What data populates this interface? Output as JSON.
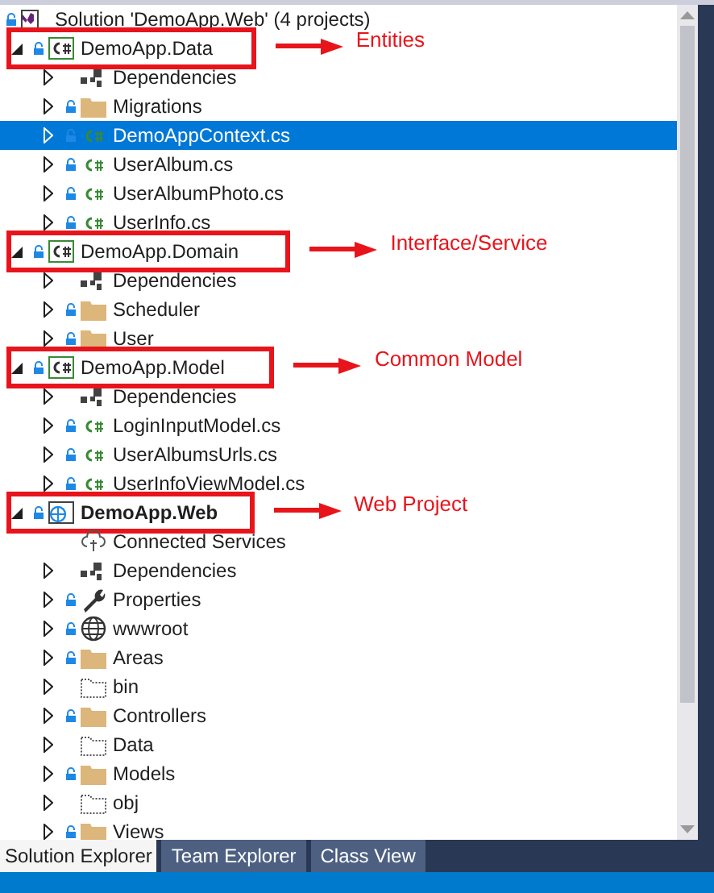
{
  "solution": {
    "title": "Solution 'DemoApp.Web' (4 projects)",
    "locked": true
  },
  "projects": [
    {
      "name": "DemoApp.Data",
      "kind": "csharp-project",
      "expandable": true,
      "expanded": true,
      "locked": true,
      "selected": false,
      "startup": false,
      "annotation": {
        "label": "Entities"
      },
      "children": [
        {
          "name": "Dependencies",
          "kind": "dependencies",
          "expandable": true,
          "expanded": false,
          "locked": false,
          "selected": false
        },
        {
          "name": "Migrations",
          "kind": "folder",
          "expandable": true,
          "expanded": false,
          "locked": true,
          "selected": false
        },
        {
          "name": "DemoAppContext.cs",
          "kind": "csharp-file",
          "expandable": true,
          "expanded": false,
          "locked": true,
          "selected": true
        },
        {
          "name": "UserAlbum.cs",
          "kind": "csharp-file",
          "expandable": true,
          "expanded": false,
          "locked": true,
          "selected": false
        },
        {
          "name": "UserAlbumPhoto.cs",
          "kind": "csharp-file",
          "expandable": true,
          "expanded": false,
          "locked": true,
          "selected": false
        },
        {
          "name": "UserInfo.cs",
          "kind": "csharp-file",
          "expandable": true,
          "expanded": false,
          "locked": true,
          "selected": false
        }
      ]
    },
    {
      "name": "DemoApp.Domain",
      "kind": "csharp-project",
      "expandable": true,
      "expanded": true,
      "locked": true,
      "selected": false,
      "startup": false,
      "annotation": {
        "label": "Interface/Service"
      },
      "children": [
        {
          "name": "Dependencies",
          "kind": "dependencies",
          "expandable": true,
          "expanded": false,
          "locked": false,
          "selected": false
        },
        {
          "name": "Scheduler",
          "kind": "folder",
          "expandable": true,
          "expanded": false,
          "locked": true,
          "selected": false
        },
        {
          "name": "User",
          "kind": "folder",
          "expandable": true,
          "expanded": false,
          "locked": true,
          "selected": false
        }
      ]
    },
    {
      "name": "DemoApp.Model",
      "kind": "csharp-project",
      "expandable": true,
      "expanded": true,
      "locked": true,
      "selected": false,
      "startup": false,
      "annotation": {
        "label": "Common Model"
      },
      "children": [
        {
          "name": "Dependencies",
          "kind": "dependencies",
          "expandable": true,
          "expanded": false,
          "locked": false,
          "selected": false
        },
        {
          "name": "LoginInputModel.cs",
          "kind": "csharp-file",
          "expandable": true,
          "expanded": false,
          "locked": true,
          "selected": false
        },
        {
          "name": "UserAlbumsUrls.cs",
          "kind": "csharp-file",
          "expandable": true,
          "expanded": false,
          "locked": true,
          "selected": false
        },
        {
          "name": "UserInfoViewModel.cs",
          "kind": "csharp-file",
          "expandable": true,
          "expanded": false,
          "locked": true,
          "selected": false
        }
      ]
    },
    {
      "name": "DemoApp.Web",
      "kind": "web-project",
      "expandable": true,
      "expanded": true,
      "locked": true,
      "selected": false,
      "startup": true,
      "annotation": {
        "label": "Web Project"
      },
      "children": [
        {
          "name": "Connected Services",
          "kind": "connected-services",
          "expandable": false,
          "locked": false,
          "selected": false
        },
        {
          "name": "Dependencies",
          "kind": "dependencies",
          "expandable": true,
          "expanded": false,
          "locked": false,
          "selected": false
        },
        {
          "name": "Properties",
          "kind": "properties",
          "expandable": true,
          "expanded": false,
          "locked": true,
          "selected": false
        },
        {
          "name": "wwwroot",
          "kind": "globe",
          "expandable": true,
          "expanded": false,
          "locked": true,
          "selected": false
        },
        {
          "name": "Areas",
          "kind": "folder",
          "expandable": true,
          "expanded": false,
          "locked": true,
          "selected": false
        },
        {
          "name": "bin",
          "kind": "excluded-folder",
          "expandable": true,
          "expanded": false,
          "locked": false,
          "selected": false
        },
        {
          "name": "Controllers",
          "kind": "folder",
          "expandable": true,
          "expanded": false,
          "locked": true,
          "selected": false
        },
        {
          "name": "Data",
          "kind": "excluded-folder",
          "expandable": true,
          "expanded": false,
          "locked": false,
          "selected": false
        },
        {
          "name": "Models",
          "kind": "folder",
          "expandable": true,
          "expanded": false,
          "locked": true,
          "selected": false
        },
        {
          "name": "obj",
          "kind": "excluded-folder",
          "expandable": true,
          "expanded": false,
          "locked": false,
          "selected": false
        },
        {
          "name": "Views",
          "kind": "folder",
          "expandable": true,
          "expanded": false,
          "locked": true,
          "selected": false
        }
      ]
    }
  ],
  "tabs": [
    {
      "label": "Solution Explorer",
      "selected": true
    },
    {
      "label": "Team Explorer",
      "selected": false
    },
    {
      "label": "Class View",
      "selected": false
    }
  ]
}
